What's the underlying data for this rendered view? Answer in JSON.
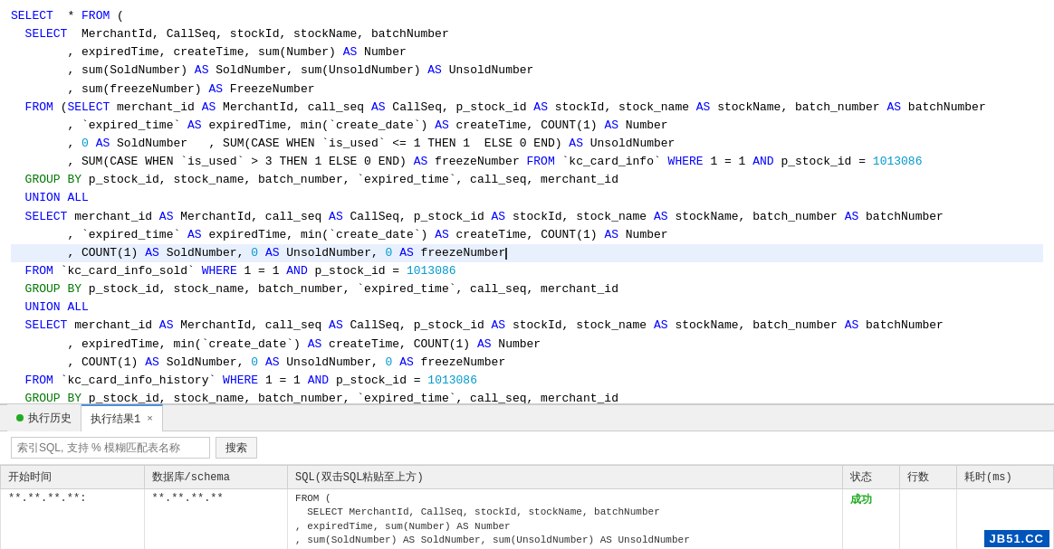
{
  "editor": {
    "lines": [
      {
        "id": 1,
        "indent": 0,
        "content": "SELECT  * FROM (",
        "highlight": false
      },
      {
        "id": 2,
        "indent": 2,
        "tokens": [
          {
            "type": "kw",
            "text": "SELECT "
          },
          {
            "type": "text",
            "text": " MerchantId, CallSeq, stockId, stockName, batchNumber"
          }
        ],
        "highlight": false
      },
      {
        "id": 3,
        "indent": 8,
        "tokens": [
          {
            "type": "text",
            "text": ", expiredTime, createTime, "
          },
          {
            "type": "text",
            "text": "sum(Number) "
          },
          {
            "type": "kw",
            "text": "AS"
          },
          {
            "type": "text",
            "text": " Number"
          }
        ],
        "highlight": false
      },
      {
        "id": 4,
        "indent": 8,
        "tokens": [
          {
            "type": "text",
            "text": ", "
          },
          {
            "type": "text",
            "text": "sum(SoldNumber) "
          },
          {
            "type": "kw",
            "text": "AS"
          },
          {
            "type": "text",
            "text": " SoldNumber, "
          },
          {
            "type": "text",
            "text": "sum(UnsoldNumber) "
          },
          {
            "type": "kw",
            "text": "AS"
          },
          {
            "type": "text",
            "text": " UnsoldNumber"
          }
        ],
        "highlight": false
      }
    ]
  },
  "tabs": {
    "history_label": "执行历史",
    "result_label": "执行结果1",
    "close_icon": "×"
  },
  "search": {
    "placeholder": "索引SQL, 支持 % 模糊匹配表名称",
    "button_label": "搜索"
  },
  "table": {
    "headers": [
      "开始时间",
      "数据库/schema",
      "SQL(双击SQL粘贴至上方)",
      "状态",
      "行数",
      "耗时(ms)"
    ],
    "row": {
      "time": "**.**.**.**:",
      "db": "**.**.**.**",
      "sql_line1": "FROM (",
      "sql_line2": "  SELECT MerchantId, CallSeq, stockId, stockName, batchNumber",
      "sql_line3": ", expiredTime, sum(Number) AS Number",
      "sql_line4": ", sum(SoldNumber) AS SoldNumber, sum(UnsoldNumber) AS UnsoldNumber",
      "status": "成功",
      "rows": "",
      "time_ms": ""
    }
  },
  "watermark": {
    "text": "JB51.CC",
    "bg_color": "#0055bb"
  }
}
